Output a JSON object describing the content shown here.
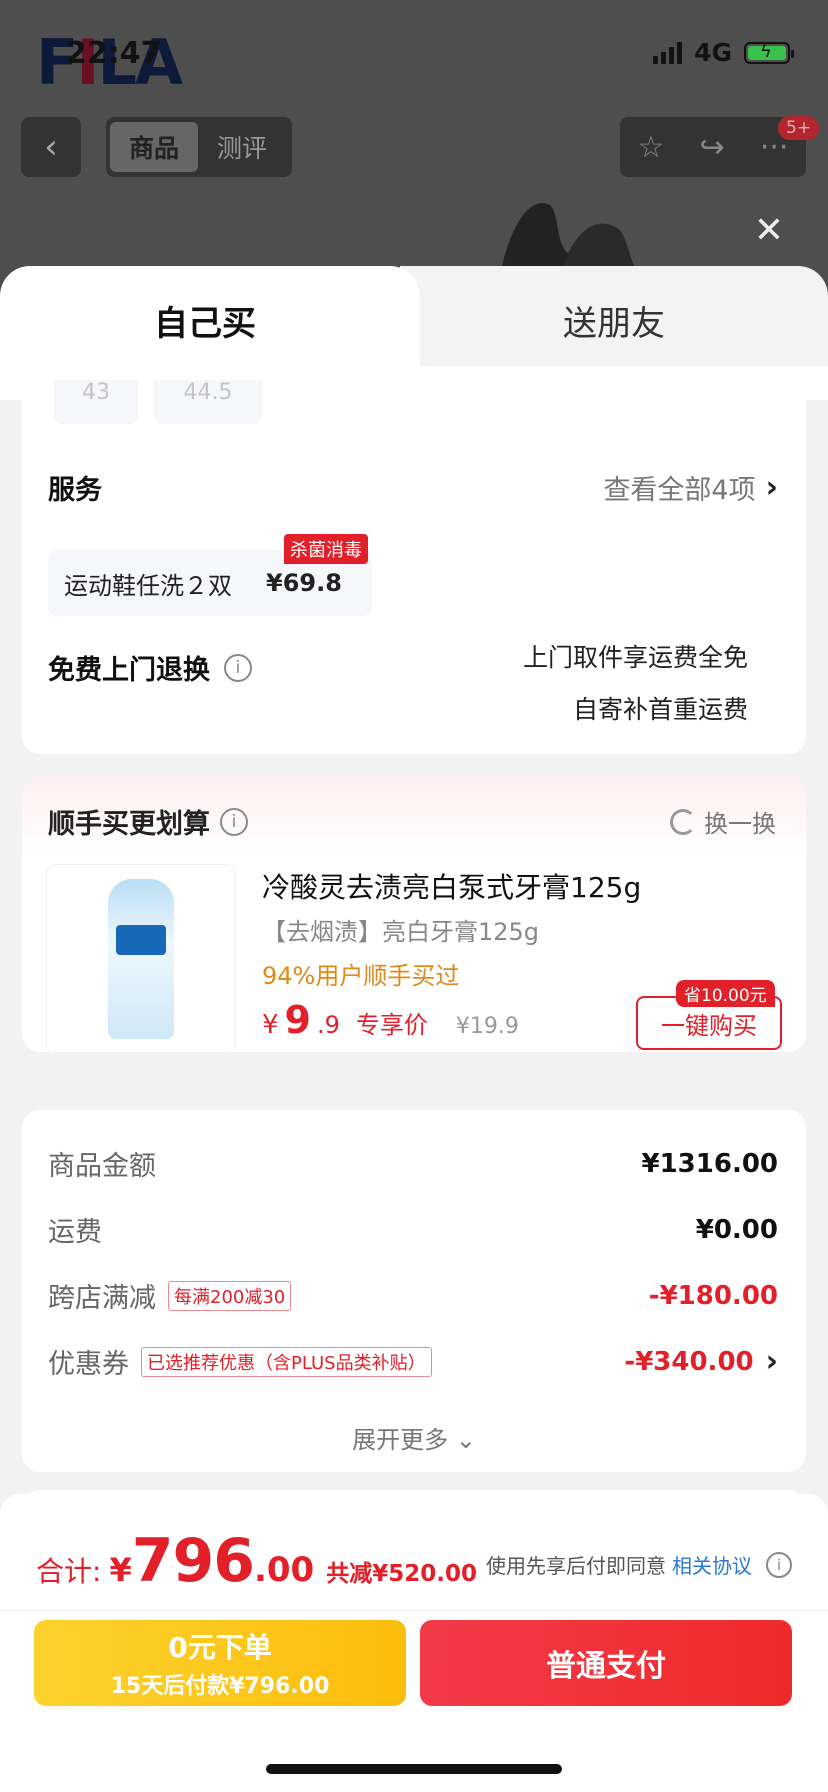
{
  "status_bar": {
    "time": "22:47",
    "network": "4G"
  },
  "brand_logo": "FILA",
  "top_nav": {
    "tabs": [
      "商品",
      "测评"
    ],
    "active_tab": "商品",
    "badge": "5+"
  },
  "sheet_tabs": {
    "self": "自己买",
    "friend": "送朋友"
  },
  "sizes": [
    "43",
    "44.5"
  ],
  "service": {
    "title": "服务",
    "view_all": "查看全部4项",
    "item_label": "运动鞋任洗２双",
    "item_price": "¥69.8",
    "item_tag": "杀菌消毒",
    "free_return_title": "免费上门退换",
    "free_return_line1": "上门取件享运费全免",
    "free_return_line2": "自寄补首重运费"
  },
  "addon": {
    "title": "顺手买更划算",
    "swap": "换一换",
    "product_name": "冷酸灵去渍亮白泵式牙膏125g",
    "product_sub": "【去烟渍】亮白牙膏125g",
    "bought": "94%用户顺手买过",
    "price_yen": "¥",
    "price_int": "9",
    "price_dec": ".9",
    "price_label": "专享价",
    "orig_price": "¥19.9",
    "save_tag": "省10.00元",
    "buy_button": "一键购买"
  },
  "summary": {
    "goods_label": "商品金额",
    "goods_value": "¥1316.00",
    "shipping_label": "运费",
    "shipping_value": "¥0.00",
    "cross_label": "跨店满减",
    "cross_tag": "每满200减30",
    "cross_value": "-¥180.00",
    "coupon_label": "优惠券",
    "coupon_tag": "已选推荐优惠（含PLUS品类补贴）",
    "coupon_value": "-¥340.00",
    "expand": "展开更多"
  },
  "footer": {
    "total_label": "合计:",
    "total_yen": "¥",
    "total_int": "796",
    "total_dec": ".00",
    "total_cut": "共减¥520.00",
    "agree_text": "使用先享后付即同意",
    "agree_link": "相关协议",
    "zero_line1": "0元下单",
    "zero_line2": "15天后付款¥796.00",
    "pay_button": "普通支付"
  },
  "colors": {
    "accent_red": "#e2202a",
    "orange": "#e08a1a",
    "yellow_button": "#fdd22e",
    "link_blue": "#2a78d0"
  }
}
